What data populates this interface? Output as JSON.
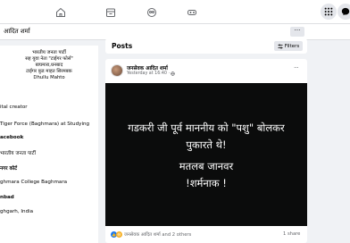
{
  "subheader": {
    "name": "आदित शर्मा",
    "more": "···"
  },
  "nav": {
    "notifications_count": "2"
  },
  "bio": {
    "lines": [
      "भारतीय जनता पार्टी",
      "सह युवा नेता \"टाईगर फोर्स\"",
      "बाघमारा,धनबाद",
      "टाईगर फ़ुड माहत सिरमबक",
      "Dhullu Mahto"
    ]
  },
  "intro": {
    "items": [
      {
        "text": "ital creator"
      },
      {
        "text": "Tiger Force (Baghmara) at Studying"
      },
      {
        "text": "acebook"
      },
      {
        "text": "भारतीय जनता पार्टी"
      },
      {
        "text": "नगर कोर्ट"
      },
      {
        "text": "ghmara College Baghmara"
      },
      {
        "text": "nbad"
      },
      {
        "text": "ghgarh, India"
      }
    ]
  },
  "posts_header": {
    "title": "Posts",
    "filters_label": "Filters"
  },
  "post": {
    "author": "जनसेवक आदित शर्मा",
    "time": "Yesterday at 16:40 · ",
    "more": "···",
    "image_lines": [
      "गडकरी जी पूर्व माननीय को \"पशु\" बोलकर",
      "पुकारते थे!",
      "मतलब जानवर",
      "!शर्मनाक !"
    ],
    "reactions_text": "जनसेवक आदित शर्मा and 2 others",
    "shares": "1 share"
  }
}
